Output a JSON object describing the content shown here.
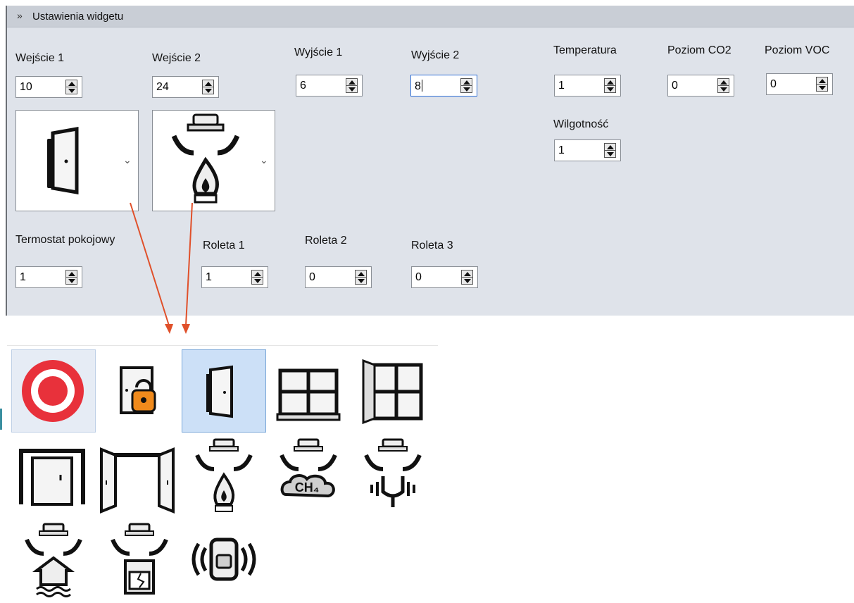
{
  "panel": {
    "title": "Ustawienia widgetu",
    "fields": [
      {
        "key": "wejscie1",
        "label": "Wejście 1",
        "value": "10"
      },
      {
        "key": "wejscie2",
        "label": "Wejście 2",
        "value": "24"
      },
      {
        "key": "wyjscie1",
        "label": "Wyjście 1",
        "value": "6"
      },
      {
        "key": "wyjscie2",
        "label": "Wyjście 2",
        "value": "8"
      },
      {
        "key": "temperatura",
        "label": "Temperatura",
        "value": "1"
      },
      {
        "key": "co2",
        "label": "Poziom CO2",
        "value": "0"
      },
      {
        "key": "voc",
        "label": "Poziom VOC",
        "value": "0"
      },
      {
        "key": "wilgotnosc",
        "label": "Wilgotność",
        "value": "1"
      },
      {
        "key": "termostat",
        "label": "Termostat pokojowy",
        "value": "1"
      },
      {
        "key": "roleta1",
        "label": "Roleta 1",
        "value": "1"
      },
      {
        "key": "roleta2",
        "label": "Roleta 2",
        "value": "0"
      },
      {
        "key": "roleta3",
        "label": "Roleta 3",
        "value": "0"
      }
    ],
    "combos": [
      {
        "key": "icon-combo-1",
        "selected_icon": "door-icon"
      },
      {
        "key": "icon-combo-2",
        "selected_icon": "smoke-detector-fire-icon"
      }
    ]
  },
  "gallery": {
    "icons": [
      "record-circle-icon",
      "door-lock-icon",
      "door-icon",
      "window-icon",
      "window-open-icon",
      "single-door-icon",
      "double-door-icon",
      "smoke-detector-fire-icon",
      "smoke-detector-ch4-icon",
      "smoke-detector-vibration-icon",
      "smoke-detector-flood-icon",
      "smoke-detector-glass-break-icon",
      "motion-sensor-icon"
    ],
    "ch4_text": "CH₄",
    "selected": [
      "record-circle-icon",
      "door-icon"
    ]
  },
  "colors": {
    "panel_bg": "#dfe3ea",
    "header_bg": "#c9ced6",
    "arrow": "#e0502a",
    "record_red": "#e8313b",
    "lock_orange": "#f08a1c",
    "selection": "#cce0f7"
  }
}
